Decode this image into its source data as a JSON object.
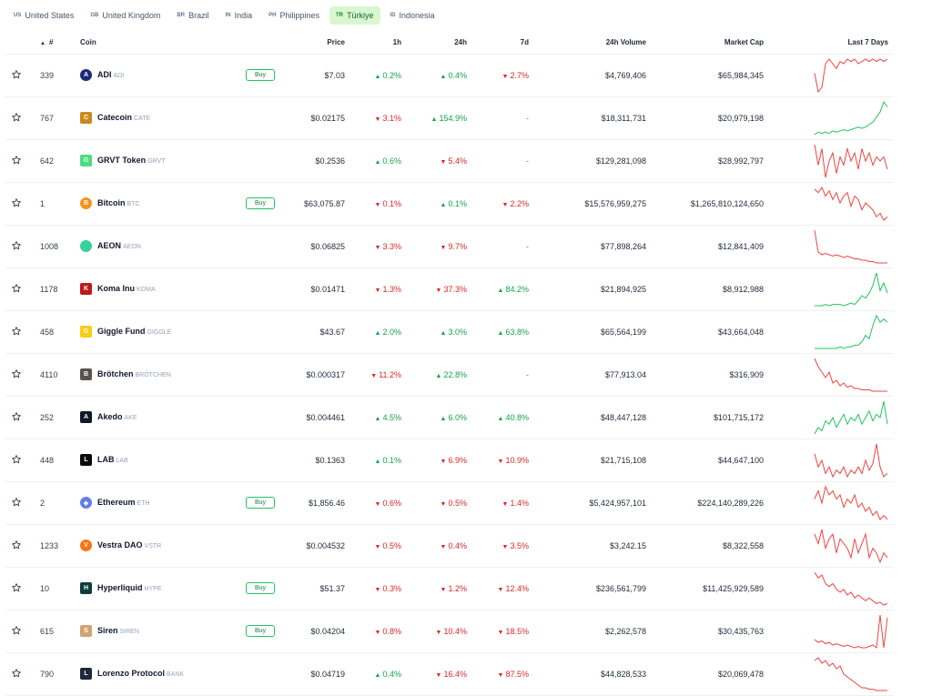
{
  "tabs": [
    {
      "code": "US",
      "label": "United States",
      "active": false
    },
    {
      "code": "GB",
      "label": "United Kingdom",
      "active": false
    },
    {
      "code": "BR",
      "label": "Brazil",
      "active": false
    },
    {
      "code": "IN",
      "label": "India",
      "active": false
    },
    {
      "code": "PH",
      "label": "Philippines",
      "active": false
    },
    {
      "code": "TR",
      "label": "Türkiye",
      "active": true
    },
    {
      "code": "ID",
      "label": "Indonesia",
      "active": false
    }
  ],
  "headers": {
    "rank": "#",
    "coin": "Coin",
    "price": "Price",
    "h1": "1h",
    "h24": "24h",
    "d7": "7d",
    "volume": "24h Volume",
    "mcap": "Market Cap",
    "last7": "Last 7 Days"
  },
  "buy_label": "Buy",
  "colors": {
    "up": "#16a34a",
    "down": "#dc2626",
    "spark_up": "#22c55e",
    "spark_down": "#ef4444",
    "active_tab_bg": "#d9f7cf"
  },
  "rows": [
    {
      "rank": "339",
      "name": "ADI",
      "symbol": "ADI",
      "icon": "adi-icon",
      "icon_color": "#1e2a78",
      "icon_text": "A",
      "buy": true,
      "price": "$7.03",
      "h1": {
        "dir": "up",
        "text": "0.2%"
      },
      "h24": {
        "dir": "up",
        "text": "0.4%"
      },
      "d7": {
        "dir": "down",
        "text": "2.7%"
      },
      "volume": "$4,769,406",
      "mcap": "$65,984,345",
      "trend": "down",
      "spark": [
        20,
        12,
        14,
        24,
        26,
        24,
        22,
        25,
        24,
        26,
        25,
        26,
        24,
        25,
        26,
        25,
        26,
        25,
        26,
        25,
        26
      ]
    },
    {
      "rank": "767",
      "name": "Catecoin",
      "symbol": "CATE",
      "icon": "catecoin-icon",
      "icon_color": "#c98a1b",
      "icon_text": "C",
      "buy": false,
      "price": "$0.02175",
      "h1": {
        "dir": "down",
        "text": "3.1%"
      },
      "h24": {
        "dir": "up",
        "text": "154.9%"
      },
      "d7": {
        "dir": "none",
        "text": "-"
      },
      "volume": "$18,311,731",
      "mcap": "$20,979,198",
      "trend": "up",
      "spark": [
        4,
        6,
        5,
        6,
        5,
        7,
        6,
        7,
        8,
        7,
        8,
        9,
        10,
        9,
        10,
        12,
        14,
        18,
        22,
        30,
        26
      ]
    },
    {
      "rank": "642",
      "name": "GRVT Token",
      "symbol": "GRVT",
      "icon": "grvt-icon",
      "icon_color": "#4ade80",
      "icon_text": "G",
      "buy": false,
      "price": "$0.2536",
      "h1": {
        "dir": "up",
        "text": "0.6%"
      },
      "h24": {
        "dir": "down",
        "text": "5.4%"
      },
      "d7": {
        "dir": "none",
        "text": "-"
      },
      "volume": "$129,281,098",
      "mcap": "$28,992,797",
      "trend": "down",
      "spark": [
        28,
        18,
        26,
        12,
        20,
        24,
        14,
        22,
        18,
        26,
        20,
        24,
        16,
        26,
        20,
        24,
        18,
        22,
        20,
        22,
        16
      ]
    },
    {
      "rank": "1",
      "name": "Bitcoin",
      "symbol": "BTC",
      "icon": "bitcoin-icon",
      "icon_color": "#f7931a",
      "icon_text": "B",
      "buy": true,
      "price": "$63,075.87",
      "h1": {
        "dir": "down",
        "text": "0.1%"
      },
      "h24": {
        "dir": "up",
        "text": "0.1%"
      },
      "d7": {
        "dir": "down",
        "text": "2.2%"
      },
      "volume": "$15,576,959,275",
      "mcap": "$1,265,810,124,650",
      "trend": "down",
      "spark": [
        26,
        24,
        27,
        22,
        25,
        20,
        24,
        18,
        22,
        24,
        16,
        22,
        20,
        14,
        18,
        16,
        14,
        10,
        12,
        8,
        10
      ]
    },
    {
      "rank": "1008",
      "name": "AEON",
      "symbol": "AEON",
      "icon": "aeon-icon",
      "icon_color": "#34d399",
      "icon_text": "",
      "buy": false,
      "price": "$0.06825",
      "h1": {
        "dir": "down",
        "text": "3.3%"
      },
      "h24": {
        "dir": "down",
        "text": "9.7%"
      },
      "d7": {
        "dir": "none",
        "text": "-"
      },
      "volume": "$77,898,264",
      "mcap": "$12,841,409",
      "trend": "down",
      "spark": [
        30,
        14,
        12,
        13,
        12,
        11,
        12,
        11,
        10,
        11,
        10,
        9,
        9,
        8,
        8,
        7,
        7,
        6,
        6,
        6,
        6
      ]
    },
    {
      "rank": "1178",
      "name": "Koma Inu",
      "symbol": "KOMA",
      "icon": "koma-icon",
      "icon_color": "#b91c1c",
      "icon_text": "K",
      "buy": false,
      "price": "$0.01471",
      "h1": {
        "dir": "down",
        "text": "1.3%"
      },
      "h24": {
        "dir": "down",
        "text": "37.3%"
      },
      "d7": {
        "dir": "up",
        "text": "84.2%"
      },
      "volume": "$21,894,925",
      "mcap": "$8,912,988",
      "trend": "up",
      "spark": [
        4,
        4,
        4,
        5,
        4,
        5,
        5,
        5,
        4,
        5,
        6,
        5,
        8,
        12,
        10,
        14,
        20,
        30,
        16,
        22,
        14
      ]
    },
    {
      "rank": "458",
      "name": "Giggle Fund",
      "symbol": "GIGGLE",
      "icon": "giggle-icon",
      "icon_color": "#facc15",
      "icon_text": "G",
      "buy": false,
      "price": "$43.67",
      "h1": {
        "dir": "up",
        "text": "2.0%"
      },
      "h24": {
        "dir": "up",
        "text": "3.0%"
      },
      "d7": {
        "dir": "up",
        "text": "63.8%"
      },
      "volume": "$65,564,199",
      "mcap": "$43,664,048",
      "trend": "up",
      "spark": [
        4,
        4,
        4,
        4,
        4,
        4,
        4,
        5,
        4,
        5,
        5,
        6,
        6,
        8,
        12,
        10,
        18,
        24,
        20,
        22,
        20
      ]
    },
    {
      "rank": "4110",
      "name": "Brötchen",
      "symbol": "BRÖTCHEN",
      "icon": "brotchen-icon",
      "icon_color": "#57534e",
      "icon_text": "B",
      "buy": false,
      "price": "$0.000317",
      "h1": {
        "dir": "down",
        "text": "11.2%"
      },
      "h24": {
        "dir": "up",
        "text": "22.8%"
      },
      "d7": {
        "dir": "none",
        "text": "-"
      },
      "volume": "$77,913.04",
      "mcap": "$316,909",
      "trend": "down",
      "spark": [
        30,
        24,
        20,
        16,
        20,
        12,
        14,
        10,
        12,
        9,
        10,
        8,
        8,
        7,
        7,
        7,
        6,
        6,
        6,
        6,
        6
      ]
    },
    {
      "rank": "252",
      "name": "Akedo",
      "symbol": "AKE",
      "icon": "akedo-icon",
      "icon_color": "#111827",
      "icon_text": "A",
      "buy": false,
      "price": "$0.004461",
      "h1": {
        "dir": "up",
        "text": "4.5%"
      },
      "h24": {
        "dir": "up",
        "text": "6.0%"
      },
      "d7": {
        "dir": "up",
        "text": "40.8%"
      },
      "volume": "$48,447,128",
      "mcap": "$101,715,172",
      "trend": "up",
      "spark": [
        6,
        10,
        8,
        14,
        12,
        16,
        10,
        14,
        18,
        12,
        16,
        14,
        18,
        12,
        16,
        20,
        14,
        18,
        16,
        26,
        12
      ]
    },
    {
      "rank": "448",
      "name": "LAB",
      "symbol": "LAB",
      "icon": "lab-icon",
      "icon_color": "#0a0a0a",
      "icon_text": "L",
      "buy": false,
      "price": "$0.1363",
      "h1": {
        "dir": "up",
        "text": "0.1%"
      },
      "h24": {
        "dir": "down",
        "text": "6.9%"
      },
      "d7": {
        "dir": "down",
        "text": "10.9%"
      },
      "volume": "$21,715,108",
      "mcap": "$44,647,100",
      "trend": "down",
      "spark": [
        22,
        14,
        18,
        10,
        14,
        8,
        12,
        10,
        14,
        8,
        12,
        10,
        14,
        10,
        18,
        12,
        16,
        28,
        14,
        8,
        10
      ]
    },
    {
      "rank": "2",
      "name": "Ethereum",
      "symbol": "ETH",
      "icon": "ethereum-icon",
      "icon_color": "#627eea",
      "icon_text": "◆",
      "buy": true,
      "price": "$1,856.46",
      "h1": {
        "dir": "down",
        "text": "0.6%"
      },
      "h24": {
        "dir": "down",
        "text": "0.5%"
      },
      "d7": {
        "dir": "down",
        "text": "1.4%"
      },
      "volume": "$5,424,957,101",
      "mcap": "$224,140,289,226",
      "trend": "down",
      "spark": [
        22,
        26,
        20,
        28,
        24,
        26,
        22,
        24,
        18,
        22,
        20,
        24,
        18,
        20,
        16,
        18,
        14,
        16,
        12,
        14,
        12
      ]
    },
    {
      "rank": "1233",
      "name": "Vestra DAO",
      "symbol": "VSTR",
      "icon": "vestra-icon",
      "icon_color": "#f97316",
      "icon_text": "V",
      "buy": false,
      "price": "$0.004532",
      "h1": {
        "dir": "down",
        "text": "0.5%"
      },
      "h24": {
        "dir": "down",
        "text": "0.4%"
      },
      "d7": {
        "dir": "down",
        "text": "3.5%"
      },
      "volume": "$3,242.15",
      "mcap": "$8,322,558",
      "trend": "down",
      "spark": [
        24,
        20,
        26,
        18,
        22,
        24,
        16,
        22,
        20,
        18,
        14,
        22,
        16,
        20,
        24,
        14,
        18,
        16,
        12,
        16,
        14
      ]
    },
    {
      "rank": "10",
      "name": "Hyperliquid",
      "symbol": "HYPE",
      "icon": "hyperliquid-icon",
      "icon_color": "#0f3d3e",
      "icon_text": "H",
      "buy": true,
      "price": "$51.37",
      "h1": {
        "dir": "down",
        "text": "0.3%"
      },
      "h24": {
        "dir": "down",
        "text": "1.2%"
      },
      "d7": {
        "dir": "down",
        "text": "12.4%"
      },
      "volume": "$236,561,799",
      "mcap": "$11,425,929,589",
      "trend": "down",
      "spark": [
        30,
        26,
        28,
        22,
        20,
        22,
        18,
        16,
        18,
        14,
        16,
        12,
        14,
        12,
        10,
        12,
        10,
        8,
        9,
        7,
        8
      ]
    },
    {
      "rank": "615",
      "name": "Siren",
      "symbol": "SIREN",
      "icon": "siren-icon",
      "icon_color": "#d4a373",
      "icon_text": "S",
      "buy": true,
      "price": "$0.04204",
      "h1": {
        "dir": "down",
        "text": "0.8%"
      },
      "h24": {
        "dir": "down",
        "text": "10.4%"
      },
      "d7": {
        "dir": "down",
        "text": "18.5%"
      },
      "volume": "$2,262,578",
      "mcap": "$30,435,763",
      "trend": "down",
      "spark": [
        12,
        10,
        11,
        9,
        10,
        8,
        9,
        8,
        7,
        8,
        7,
        6,
        7,
        6,
        6,
        7,
        8,
        6,
        30,
        6,
        28
      ]
    },
    {
      "rank": "790",
      "name": "Lorenzo Protocol",
      "symbol": "BANK",
      "icon": "lorenzo-icon",
      "icon_color": "#1f2937",
      "icon_text": "L",
      "buy": false,
      "price": "$0.04719",
      "h1": {
        "dir": "up",
        "text": "0.4%"
      },
      "h24": {
        "dir": "down",
        "text": "16.4%"
      },
      "d7": {
        "dir": "down",
        "text": "87.5%"
      },
      "volume": "$44,828,533",
      "mcap": "$20,069,478",
      "trend": "down",
      "spark": [
        26,
        28,
        24,
        26,
        22,
        24,
        20,
        22,
        16,
        14,
        12,
        10,
        8,
        6,
        6,
        5,
        5,
        4,
        4,
        4,
        4
      ]
    }
  ]
}
